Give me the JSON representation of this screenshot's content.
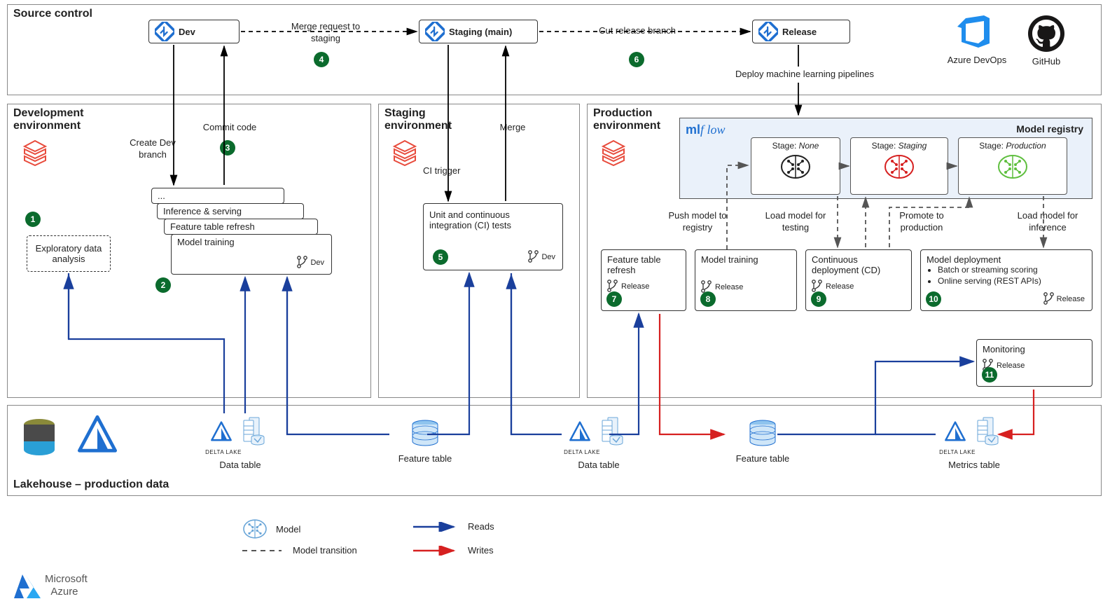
{
  "sections": {
    "source_control": "Source control",
    "dev_env": "Development environment",
    "staging_env": "Staging environment",
    "prod_env": "Production environment",
    "lakehouse": "Lakehouse – production data"
  },
  "source_control": {
    "dev": "Dev",
    "staging": "Staging (main)",
    "release": "Release",
    "merge_request": "Merge request to staging",
    "cut_release": "Cut release branch",
    "deploy_pipelines": "Deploy machine learning pipelines",
    "azure_devops": "Azure DevOps",
    "github": "GitHub"
  },
  "dev": {
    "create_branch": "Create Dev branch",
    "commit_code": "Commit code",
    "eda": "Exploratory data analysis",
    "stack_ellipsis": "...",
    "stack_inference": "Inference & serving",
    "stack_feature": "Feature table refresh",
    "stack_training": "Model training",
    "branch_label": "Dev"
  },
  "staging": {
    "ci_trigger": "CI trigger",
    "merge": "Merge",
    "ci_tests": "Unit and continuous integration (CI) tests",
    "branch_label": "Dev"
  },
  "prod": {
    "mlflow": "mlf low",
    "model_registry": "Model registry",
    "stage_none": "Stage: None",
    "stage_staging": "Stage: Staging",
    "stage_production": "Stage: Production",
    "push_model": "Push model to registry",
    "load_testing": "Load model for testing",
    "promote": "Promote to production",
    "load_inference": "Load model for inference",
    "feature_refresh": "Feature table refresh",
    "model_training": "Model training",
    "cd": "Continuous deployment (CD)",
    "model_deploy_title": "Model deployment",
    "model_deploy_b1": "Batch or streaming scoring",
    "model_deploy_b2": "Online serving (REST APIs)",
    "monitoring": "Monitoring",
    "branch_label": "Release"
  },
  "lakehouse": {
    "delta_lake": "DELTA LAKE",
    "data_table": "Data table",
    "feature_table": "Feature table",
    "metrics_table": "Metrics table"
  },
  "legend": {
    "model": "Model",
    "model_transition": "Model transition",
    "reads": "Reads",
    "writes": "Writes"
  },
  "footer": {
    "microsoft": "Microsoft",
    "azure": "Azure"
  },
  "badges": {
    "b1": "1",
    "b2": "2",
    "b3": "3",
    "b4": "4",
    "b5": "5",
    "b6": "6",
    "b7": "7",
    "b8": "8",
    "b9": "9",
    "b10": "10",
    "b11": "11"
  },
  "none_text": "None",
  "staging_text": "Staging",
  "production_text": "Production",
  "stage_prefix": "Stage: "
}
